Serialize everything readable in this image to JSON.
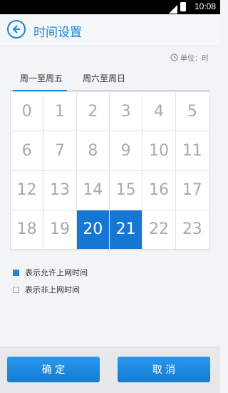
{
  "status_bar": {
    "time": "10:08"
  },
  "header": {
    "title": "时间设置"
  },
  "unit_label": "单位：时",
  "tabs": [
    {
      "label": "周一至周五",
      "active": true
    },
    {
      "label": "周六至周日",
      "active": false
    }
  ],
  "hours": [
    {
      "label": "0",
      "selected": false
    },
    {
      "label": "1",
      "selected": false
    },
    {
      "label": "2",
      "selected": false
    },
    {
      "label": "3",
      "selected": false
    },
    {
      "label": "4",
      "selected": false
    },
    {
      "label": "5",
      "selected": false
    },
    {
      "label": "6",
      "selected": false
    },
    {
      "label": "7",
      "selected": false
    },
    {
      "label": "8",
      "selected": false
    },
    {
      "label": "9",
      "selected": false
    },
    {
      "label": "10",
      "selected": false
    },
    {
      "label": "11",
      "selected": false
    },
    {
      "label": "12",
      "selected": false
    },
    {
      "label": "13",
      "selected": false
    },
    {
      "label": "14",
      "selected": false
    },
    {
      "label": "15",
      "selected": false
    },
    {
      "label": "16",
      "selected": false
    },
    {
      "label": "17",
      "selected": false
    },
    {
      "label": "18",
      "selected": false
    },
    {
      "label": "19",
      "selected": false
    },
    {
      "label": "20",
      "selected": true
    },
    {
      "label": "21",
      "selected": true
    },
    {
      "label": "22",
      "selected": false
    },
    {
      "label": "23",
      "selected": false
    }
  ],
  "legend": {
    "allowed": "表示允许上网时间",
    "not_allowed": "表示非上网时间"
  },
  "buttons": {
    "confirm": "确 定",
    "cancel": "取 消"
  },
  "colors": {
    "accent": "#1a86d9",
    "selected": "#1677d2"
  }
}
